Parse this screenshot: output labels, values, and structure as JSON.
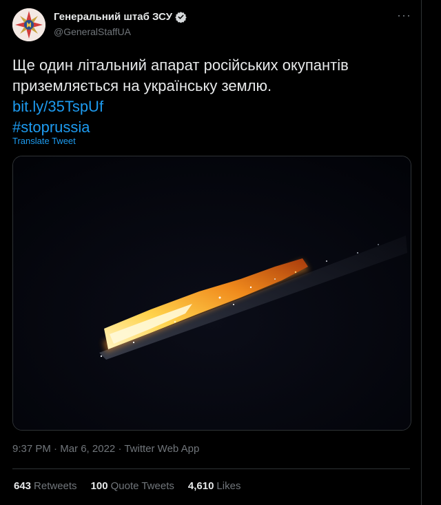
{
  "tweet": {
    "author": {
      "display_name": "Генеральний штаб ЗСУ",
      "handle": "@GeneralStaffUA",
      "verified": true,
      "avatar_icon": "general-staff-emblem-icon"
    },
    "more_icon": "more-dots-icon",
    "text_lines": [
      "Ще один літальний апарат російських окупантів",
      "приземляється на українську землю."
    ],
    "link": "bit.ly/35TspUf",
    "hashtag": "#stoprussia",
    "translate_label": "Translate Tweet",
    "media": {
      "description_icon": "burning-aircraft-night-image"
    },
    "time": "9:37 PM",
    "date": "Mar 6, 2022",
    "separator": "·",
    "source": "Twitter Web App",
    "stats": {
      "retweets": {
        "count": "643",
        "label": "Retweets"
      },
      "quote_tweets": {
        "count": "100",
        "label": "Quote Tweets"
      },
      "likes": {
        "count": "4,610",
        "label": "Likes"
      }
    }
  },
  "colors": {
    "background": "#000000",
    "text": "#e7e9ea",
    "muted": "#71767b",
    "link": "#1d9bf0",
    "border": "#2f3336"
  }
}
